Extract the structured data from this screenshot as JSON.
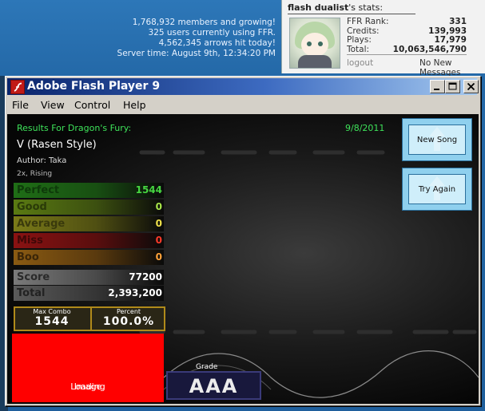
{
  "site": {
    "stats": [
      "1,768,932 members and growing!",
      "325 users currently using FFR.",
      "4,562,345 arrows hit today!",
      "Server time: August 9th, 12:34:20 PM"
    ],
    "user_panel": {
      "username": "flash dualist",
      "title_suffix": "'s stats:",
      "rows": [
        {
          "label": "FFR Rank:",
          "value": "331"
        },
        {
          "label": "Credits:",
          "value": "139,993"
        },
        {
          "label": "Plays:",
          "value": "17,979"
        },
        {
          "label": "Total:",
          "value": "10,063,546,790"
        }
      ],
      "logout_label": "logout",
      "messages_label": "No New Messages"
    }
  },
  "window": {
    "title": "Adobe Flash Player 9",
    "menu": [
      "File",
      "View",
      "Control",
      "Help"
    ]
  },
  "results": {
    "header": "Results For Dragon's Fury:",
    "date": "9/8/2011",
    "song": "V (Rasen Style)",
    "author": "Author: Taka",
    "mods": "2x, Rising",
    "judges": {
      "perfect": {
        "label": "Perfect",
        "value": "1544"
      },
      "good": {
        "label": "Good",
        "value": "0"
      },
      "average": {
        "label": "Average",
        "value": "0"
      },
      "miss": {
        "label": "Miss",
        "value": "0"
      },
      "boo": {
        "label": "Boo",
        "value": "0"
      }
    },
    "score": {
      "label": "Score",
      "value": "77200"
    },
    "total": {
      "label": "Total",
      "value": "2,393,200"
    },
    "max_combo": {
      "label": "Max Combo",
      "value": "1544"
    },
    "percent": {
      "label": "Percent",
      "value": "100.0%"
    },
    "image_placeholder": {
      "line1": "Image",
      "line2": "Loading"
    },
    "grade": {
      "label": "Grade",
      "value": "AAA"
    }
  },
  "buttons": {
    "new_song": "New Song",
    "try_again": "Try Again"
  },
  "colors": {
    "accent_green": "#3ee35a",
    "image_placeholder_red": "#ff0000",
    "button_blue": "#8fd0ee"
  }
}
